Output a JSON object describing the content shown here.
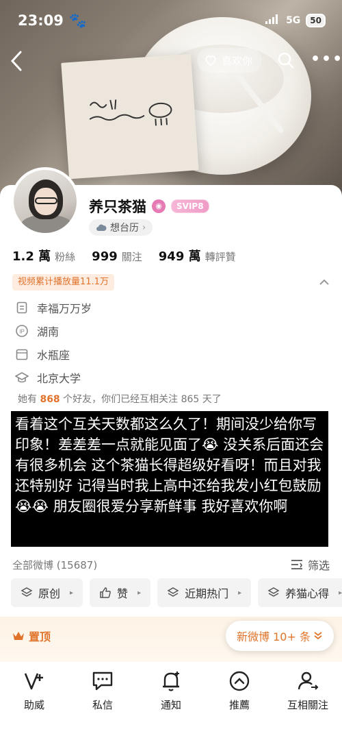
{
  "status_bar": {
    "time": "23:09",
    "network": "5G",
    "battery": "50"
  },
  "header": {
    "like_button_label": "喜欢你"
  },
  "profile": {
    "name": "养只茶猫",
    "vip_badge": "SVIP8",
    "location_label": "想台历",
    "stats": [
      {
        "num": "1.2 萬",
        "label": "粉絲"
      },
      {
        "num": "999",
        "label": "關注"
      },
      {
        "num": "949 萬",
        "label": "轉評贊"
      }
    ],
    "play_count_tag": "视频累计播放量11.1万",
    "info": [
      {
        "icon": "document-icon",
        "text": "幸福万万岁"
      },
      {
        "icon": "ip-icon",
        "text": "湖南"
      },
      {
        "icon": "calendar-icon",
        "text": "水瓶座"
      },
      {
        "icon": "graduation-cap-icon",
        "text": "北京大学"
      }
    ],
    "friends_line": {
      "prefix": "她有",
      "count": "868",
      "suffix": "个好友，你们已经互相关注 865 天了"
    }
  },
  "overlay": {
    "text": "看着这个互关天数都这么久了！期间没少给你写印象！差差差一点就能见面了😭 没关系后面还会有很多机会 这个茶猫长得超级好看呀！而且对我还特别好 记得当时我上高中还给我发小红包鼓励😭😭 朋友圈很爱分享新鲜事 我好喜欢你啊"
  },
  "weibo": {
    "all_label": "全部微博 (15687)",
    "filter_label": "筛选",
    "chips": [
      {
        "icon": "layers-icon",
        "label": "原创"
      },
      {
        "icon": "thumbs-up-icon",
        "label": "赞"
      },
      {
        "icon": "layers-icon",
        "label": "近期热门"
      },
      {
        "icon": "layers-icon",
        "label": "养猫心得"
      }
    ],
    "pinned_label": "置顶",
    "new_weibo_label": "新微博 10+ 条"
  },
  "bottom_nav": [
    {
      "icon": "v-plus-icon",
      "label": "助威"
    },
    {
      "icon": "chat-icon",
      "label": "私信"
    },
    {
      "icon": "bell-icon",
      "label": "通知"
    },
    {
      "icon": "up-circle-icon",
      "label": "推薦"
    },
    {
      "icon": "user-follow-icon",
      "label": "互相關注"
    }
  ],
  "colors": {
    "accent_orange": "#e2722c",
    "vip_pink": "#f09bc7"
  }
}
